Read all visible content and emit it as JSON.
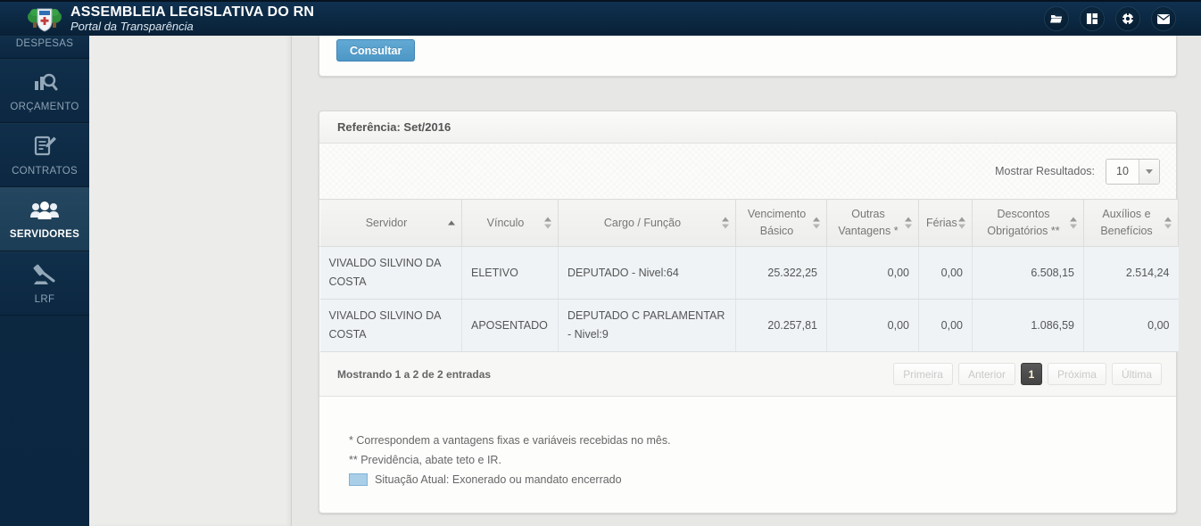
{
  "header": {
    "title": "ASSEMBLEIA LEGISLATIVA DO RN",
    "subtitle": "Portal da Transparência",
    "action_icons": [
      "folder-icon",
      "grid-icon",
      "help-ring-icon",
      "mail-icon"
    ]
  },
  "sidebar": {
    "items": [
      {
        "label": "DESPESAS",
        "icon": "expenses-icon",
        "active": false
      },
      {
        "label": "ORÇAMENTO",
        "icon": "budget-icon",
        "active": false
      },
      {
        "label": "CONTRATOS",
        "icon": "contracts-icon",
        "active": false
      },
      {
        "label": "SERVIDORES",
        "icon": "people-icon",
        "active": true
      },
      {
        "label": "LRF",
        "icon": "gavel-icon",
        "active": false
      }
    ]
  },
  "filter_panel": {
    "consult_button": "Consultar"
  },
  "results_panel": {
    "title": "Referência: Set/2016",
    "show_results_label": "Mostrar Resultados:",
    "page_size": "10",
    "table": {
      "columns": [
        {
          "label": "Servidor",
          "sort": "asc"
        },
        {
          "label": "Vínculo",
          "sort": "none"
        },
        {
          "label": "Cargo / Função",
          "sort": "none"
        },
        {
          "label": "Vencimento Básico",
          "sort": "none"
        },
        {
          "label": "Outras Vantagens *",
          "sort": "none"
        },
        {
          "label": "Férias",
          "sort": "none"
        },
        {
          "label": "Descontos Obrigatórios **",
          "sort": "none"
        },
        {
          "label": "Auxílios e Benefícios",
          "sort": "none"
        }
      ],
      "rows": [
        [
          "VIVALDO SILVINO DA COSTA",
          "ELETIVO",
          "DEPUTADO - Nivel:64",
          "25.322,25",
          "0,00",
          "0,00",
          "6.508,15",
          "2.514,24"
        ],
        [
          "VIVALDO SILVINO DA COSTA",
          "APOSENTADO",
          "DEPUTADO C PARLAMENTAR - Nivel:9",
          "20.257,81",
          "0,00",
          "0,00",
          "1.086,59",
          "0,00"
        ]
      ],
      "row_highlight_color": "#eff3f6"
    },
    "pagination": {
      "summary": "Mostrando 1 a 2 de 2 entradas",
      "first": "Primeira",
      "prev": "Anterior",
      "page": "1",
      "next": "Próxima",
      "last": "Última"
    },
    "footnotes": {
      "note1": "* Correspondem a vantagens fixas e variáveis recebidas no mês.",
      "note2": "** Previdência, abate teto e IR.",
      "legend_text": "Situação Atual: Exonerado ou mandato encerrado",
      "legend_color": "#a9cfe8"
    }
  },
  "colors": {
    "accent_blue": "#4d97c6",
    "header_navy": "#0b2740"
  }
}
